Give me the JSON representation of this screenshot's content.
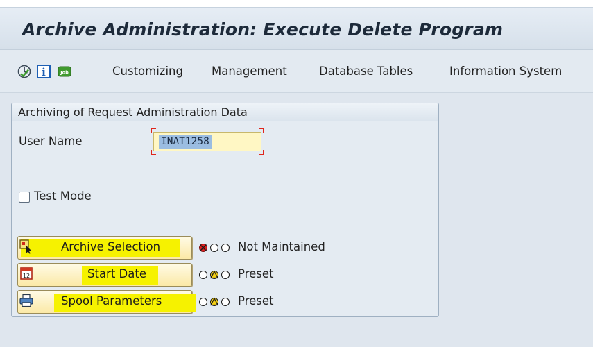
{
  "window": {
    "title": "Archive Administration: Execute Delete Program"
  },
  "toolbar": {
    "icons": [
      "execute-icon",
      "info-icon",
      "job-icon"
    ],
    "job_icon_text": "Job",
    "info_icon_text": "i",
    "menu": [
      "Customizing",
      "Management",
      "Database Tables",
      "Information System"
    ]
  },
  "group": {
    "title": "Archiving of Request Administration Data",
    "user_name_label": "User Name",
    "user_name_value": "INAT1258",
    "test_mode_label": "Test Mode",
    "test_mode_checked": false,
    "highlight_color": "#f6f200",
    "button_color": "#fbe9a6",
    "buttons": [
      {
        "label": "Archive Selection",
        "icon": "archive-selection-icon",
        "status": "Not Maintained",
        "status_light": "red"
      },
      {
        "label": "Start Date",
        "icon": "calendar-icon",
        "status": "Preset",
        "status_light": "yellow"
      },
      {
        "label": "Spool Parameters",
        "icon": "printer-icon",
        "status": "Preset",
        "status_light": "yellow"
      }
    ]
  }
}
